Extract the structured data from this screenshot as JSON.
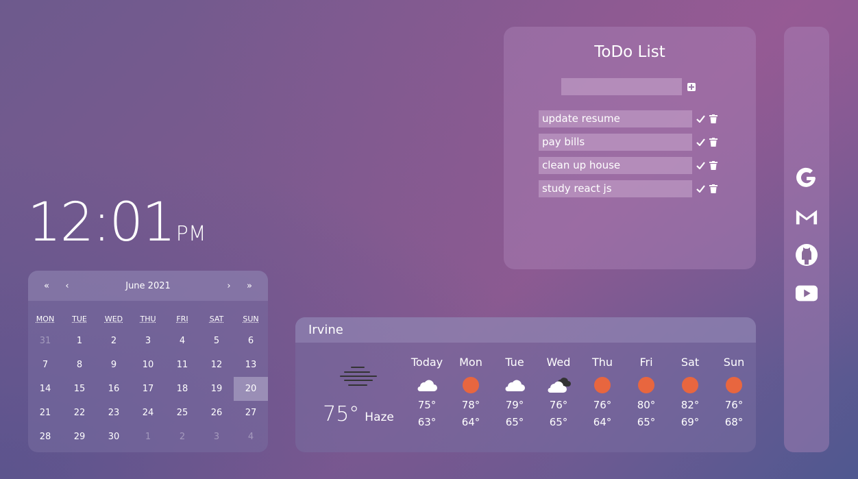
{
  "clock": {
    "time": "12:01",
    "ampm": "PM"
  },
  "calendar": {
    "prev_year": "«",
    "prev_month": "‹",
    "month_label": "June 2021",
    "next_month": "›",
    "next_year": "»",
    "weekdays": [
      "MON",
      "TUE",
      "WED",
      "THU",
      "FRI",
      "SAT",
      "SUN"
    ],
    "days": [
      "31",
      "1",
      "2",
      "3",
      "4",
      "5",
      "6",
      "7",
      "8",
      "9",
      "10",
      "11",
      "12",
      "13",
      "14",
      "15",
      "16",
      "17",
      "18",
      "19",
      "20",
      "21",
      "22",
      "23",
      "24",
      "25",
      "26",
      "27",
      "28",
      "29",
      "30",
      "1",
      "2",
      "3",
      "4"
    ],
    "selected_day": "20"
  },
  "weather": {
    "city": "Irvine",
    "current_temp": "75°",
    "current_condition": "Haze",
    "forecast": [
      {
        "day": "Today",
        "icon": "cloud-icon",
        "hi": "75°",
        "lo": "63°"
      },
      {
        "day": "Mon",
        "icon": "sun-icon",
        "hi": "78°",
        "lo": "64°"
      },
      {
        "day": "Tue",
        "icon": "cloud-icon",
        "hi": "79°",
        "lo": "65°"
      },
      {
        "day": "Wed",
        "icon": "cloud-dark-icon",
        "hi": "76°",
        "lo": "65°"
      },
      {
        "day": "Thu",
        "icon": "sun-icon",
        "hi": "76°",
        "lo": "64°"
      },
      {
        "day": "Fri",
        "icon": "sun-icon",
        "hi": "80°",
        "lo": "65°"
      },
      {
        "day": "Sat",
        "icon": "sun-icon",
        "hi": "82°",
        "lo": "69°"
      },
      {
        "day": "Sun",
        "icon": "sun-icon",
        "hi": "76°",
        "lo": "68°"
      }
    ],
    "sun_color": "#e8663f"
  },
  "todo": {
    "title": "ToDo List",
    "input_value": "",
    "items": [
      "update resume",
      "pay bills",
      "clean up house",
      "study react js"
    ]
  },
  "sidebar": {
    "links": [
      "google-icon",
      "gmail-icon",
      "github-icon",
      "youtube-icon"
    ]
  }
}
